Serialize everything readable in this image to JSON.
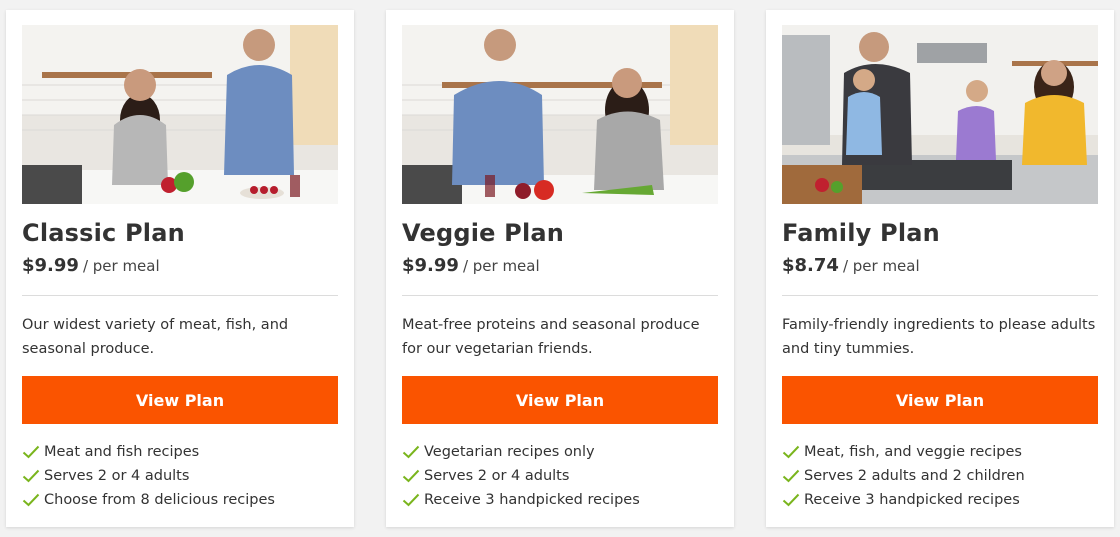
{
  "plans": [
    {
      "title": "Classic Plan",
      "price": "$9.99",
      "per_meal": "/ per meal",
      "description": "Our widest variety of meat, fish, and seasonal produce.",
      "button_label": "View Plan",
      "features": [
        "Meat and fish recipes",
        "Serves 2 or 4 adults",
        "Choose from 8 delicious recipes"
      ]
    },
    {
      "title": "Veggie Plan",
      "price": "$9.99",
      "per_meal": "/ per meal",
      "description": "Meat-free proteins and seasonal produce for our vegetarian friends.",
      "button_label": "View Plan",
      "features": [
        "Vegetarian recipes only",
        "Serves 2 or 4 adults",
        "Receive 3 handpicked recipes"
      ]
    },
    {
      "title": "Family Plan",
      "price": "$8.74",
      "per_meal": "/ per meal",
      "description": "Family-friendly ingredients to please adults and tiny tummies.",
      "button_label": "View Plan",
      "features": [
        "Meat, fish, and veggie recipes",
        "Serves 2 adults and 2 children",
        "Receive 3 handpicked recipes"
      ]
    }
  ],
  "colors": {
    "accent": "#fa5400",
    "check": "#7ab51d",
    "text": "#333333"
  },
  "icons": {
    "feature_bullet": "checkmark-icon"
  }
}
